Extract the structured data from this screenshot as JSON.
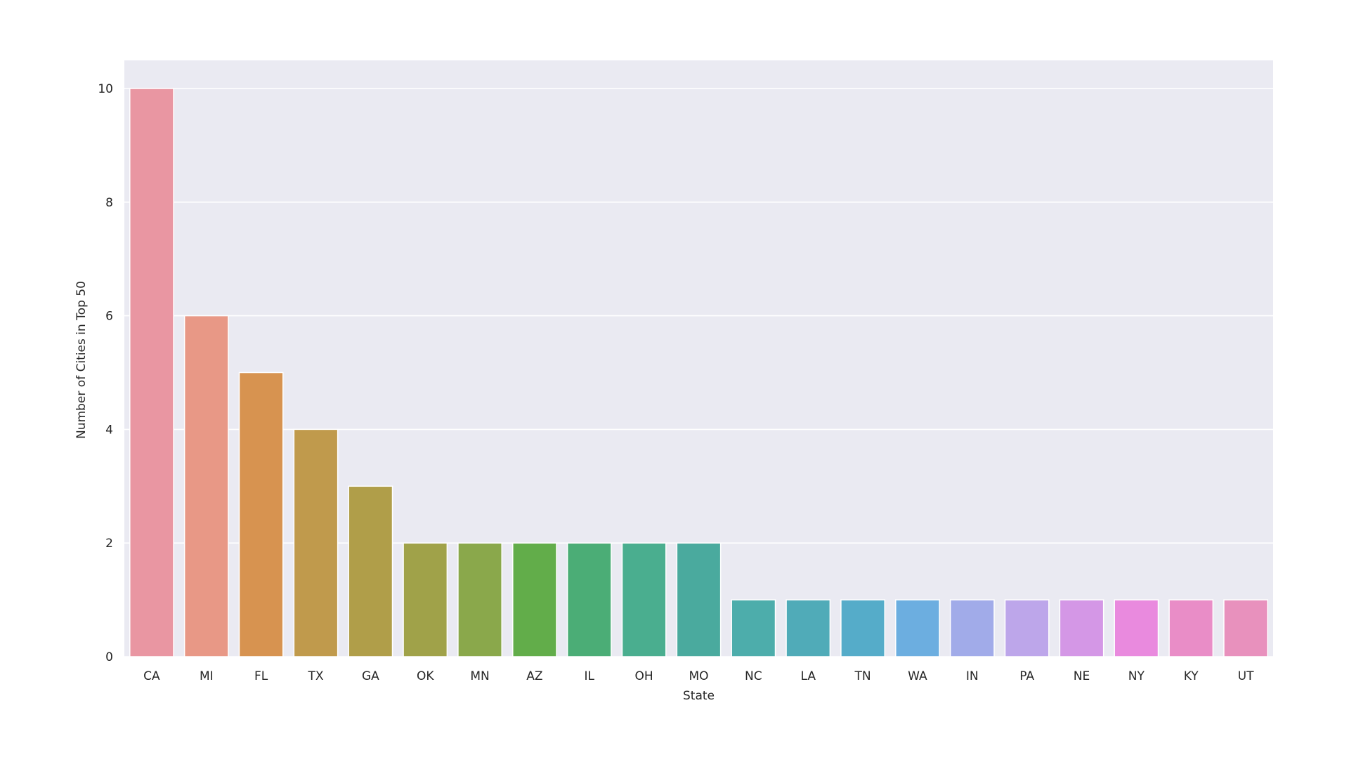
{
  "chart_data": {
    "type": "bar",
    "title": "",
    "xlabel": "State",
    "ylabel": "Number of Cities in Top 50",
    "categories": [
      "CA",
      "MI",
      "FL",
      "TX",
      "GA",
      "OK",
      "MN",
      "AZ",
      "IL",
      "OH",
      "MO",
      "NC",
      "LA",
      "TN",
      "WA",
      "IN",
      "PA",
      "NE",
      "NY",
      "KY",
      "UT"
    ],
    "values": [
      10,
      6,
      5,
      4,
      3,
      2,
      2,
      2,
      2,
      2,
      2,
      1,
      1,
      1,
      1,
      1,
      1,
      1,
      1,
      1,
      1
    ],
    "colors": [
      "#e996a2",
      "#e89886",
      "#d79350",
      "#c09a4c",
      "#b09e49",
      "#a0a249",
      "#8aa84b",
      "#62ad4a",
      "#4bad76",
      "#4aae8f",
      "#4aaa9e",
      "#4dadab",
      "#50abb8",
      "#55acc9",
      "#6caee0",
      "#a1abe9",
      "#bda6ea",
      "#d497e6",
      "#e98ade",
      "#e98dc7",
      "#e891bd"
    ],
    "ylim": [
      0,
      10.5
    ],
    "yticks": [
      "0",
      "2",
      "4",
      "6",
      "8",
      "10"
    ],
    "grid": true,
    "legend": "none",
    "style": {
      "background": "#eaeaf2",
      "grid_color": "#ffffff"
    }
  }
}
